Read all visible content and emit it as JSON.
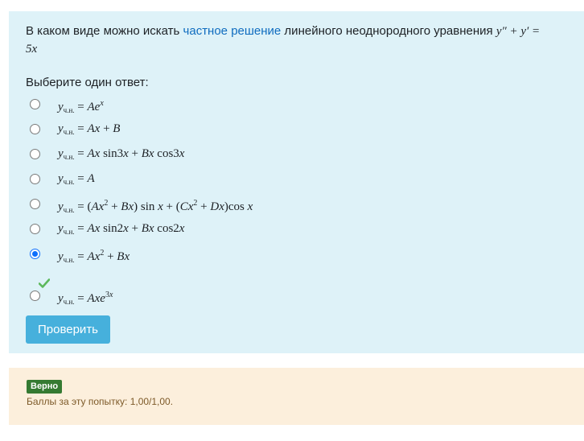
{
  "question": {
    "text_before": "В каком виде можно искать ",
    "link_text": "частное решение",
    "text_after": " линейного неоднородного уравнения ",
    "equation_line1": "y″ + y′ =",
    "equation_line2": "5x"
  },
  "prompt": "Выберите один ответ:",
  "subscript_label": "ч.н.",
  "options": [
    {
      "formula": "= Ae^x",
      "selected": false
    },
    {
      "formula": "= Ax + B",
      "selected": false
    },
    {
      "formula": "= Ax sin3x + Bx cos3x",
      "selected": false
    },
    {
      "formula": "= A",
      "selected": false
    },
    {
      "formula": "= (Ax^2 + Bx) sin x + (Cx^2 + Dx)cos x",
      "selected": false
    },
    {
      "formula": "= Ax sin2x + Bx cos2x",
      "selected": false
    },
    {
      "formula": "= Ax^2 + Bx",
      "selected": true
    },
    {
      "formula": "= Axe^3x",
      "selected": false
    }
  ],
  "check_button_label": "Проверить",
  "feedback": {
    "badge": "Верно",
    "score_text": "Баллы за эту попытку: 1,00/1,00."
  },
  "colors": {
    "question_bg": "#def2f8",
    "feedback_bg": "#fcefdc",
    "button_bg": "#46b0dc",
    "badge_bg": "#357a32",
    "check_mark": "#5cb85c"
  },
  "icons": {
    "correct": "checkmark-icon"
  }
}
